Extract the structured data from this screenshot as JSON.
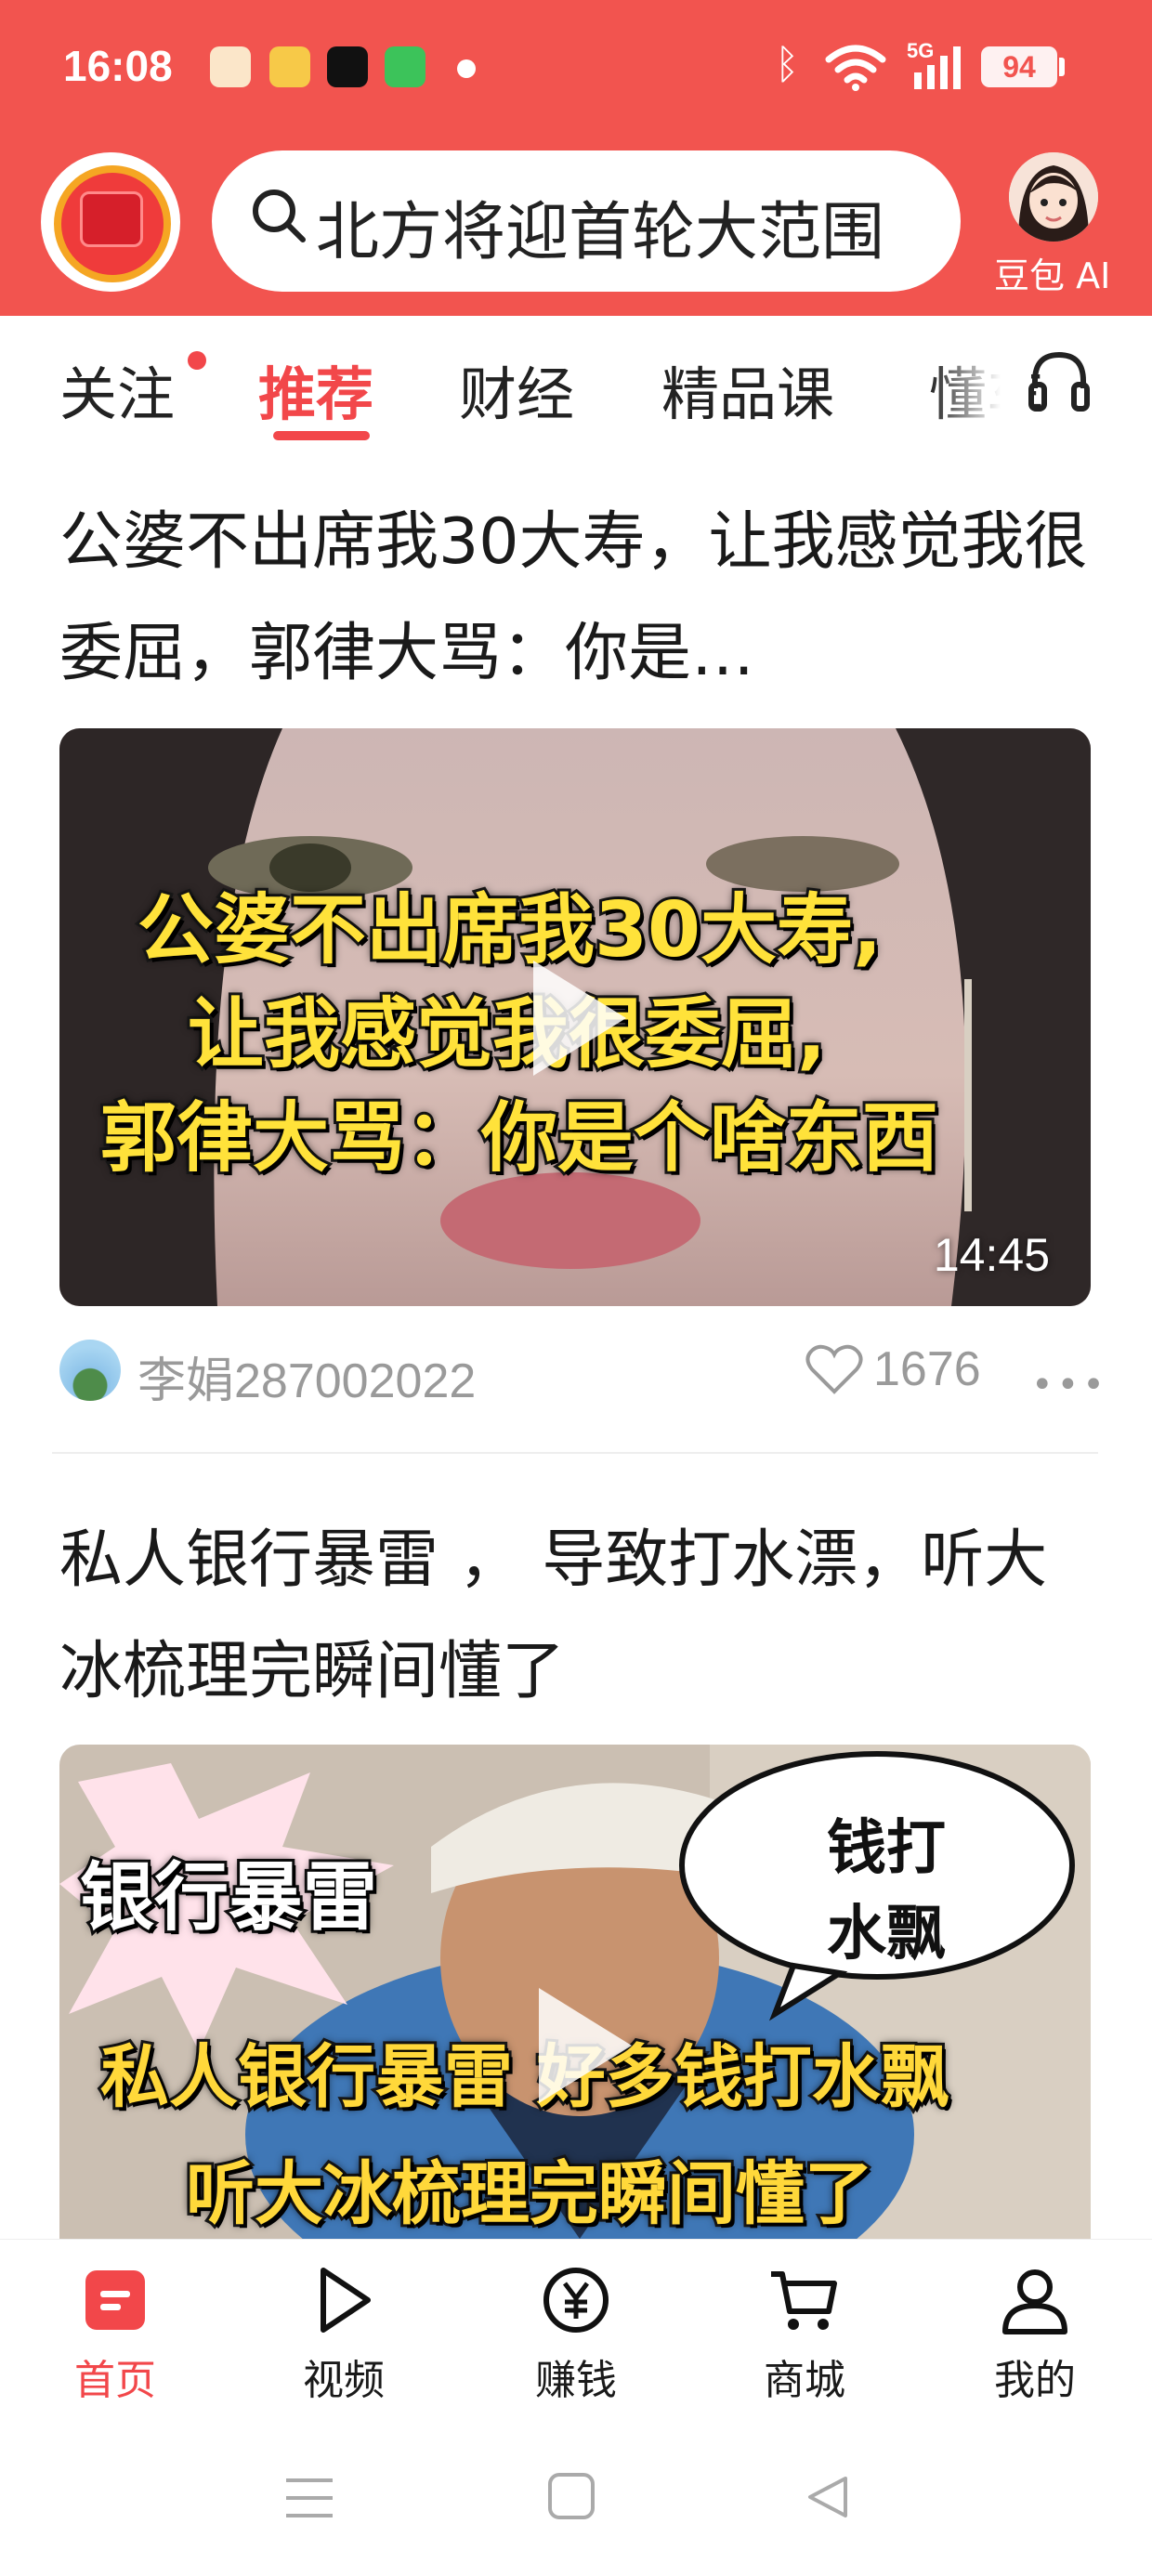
{
  "status_bar": {
    "time": "16:08",
    "network": "5G",
    "battery": "94",
    "notification_icons": [
      "app-icon-1",
      "weibo-icon",
      "tiktok-icon",
      "message-icon"
    ]
  },
  "header": {
    "search_text": "北方将迎首轮大范围",
    "assistant_label": "豆包 AI"
  },
  "tabs": [
    {
      "label": "关注"
    },
    {
      "label": "推荐",
      "active": true
    },
    {
      "label": "财经"
    },
    {
      "label": "精品课"
    },
    {
      "label": "懂车"
    }
  ],
  "articles": [
    {
      "title": "公婆不出席我30大寿，让我感觉我很委屈，郭律大骂：你是…",
      "thumb_captions": [
        "公婆不出席我30大寿,",
        "让我感觉我很委屈,",
        "郭律大骂：你是个啥东西"
      ],
      "duration": "14:45",
      "author": "李娟287002022",
      "likes": "1676"
    },
    {
      "title": "私人银行暴雷 ， 导致打水漂，听大冰梳理完瞬间懂了",
      "thumb_captions": {
        "burst": "银行暴雷",
        "bubble": "钱打水飘",
        "line1": "私人银行暴雷 好多钱打水飘",
        "line2": "听大冰梳理完瞬间懂了"
      }
    }
  ],
  "bottom_nav": [
    {
      "label": "首页",
      "icon": "home-icon",
      "active": true
    },
    {
      "label": "视频",
      "icon": "video-play-icon"
    },
    {
      "label": "赚钱",
      "icon": "yuan-coin-icon"
    },
    {
      "label": "商城",
      "icon": "cart-icon"
    },
    {
      "label": "我的",
      "icon": "profile-icon"
    }
  ],
  "colors": {
    "brand": "#f2544f",
    "accent": "#f2474a",
    "muted": "#9a9a9a"
  }
}
